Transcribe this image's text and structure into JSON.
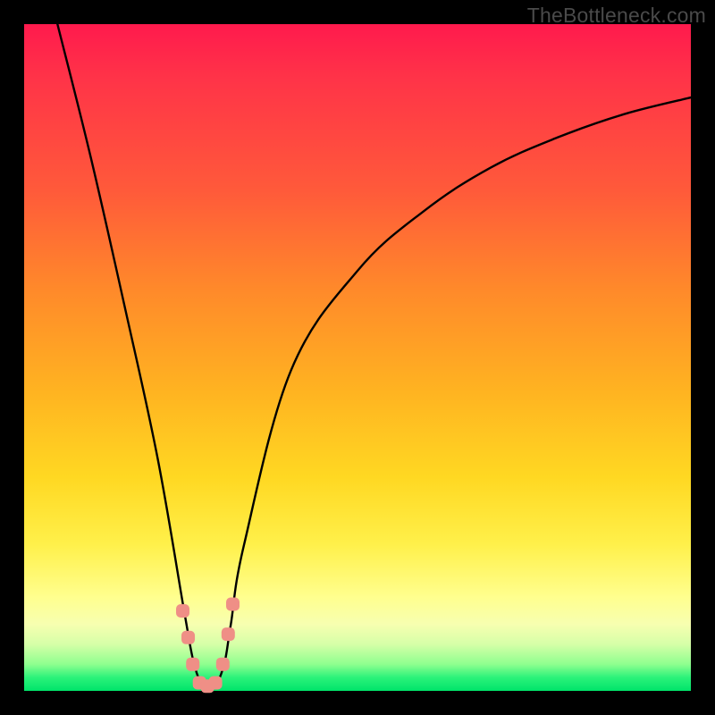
{
  "watermark": "TheBottleneck.com",
  "chart_data": {
    "type": "line",
    "title": "",
    "xlabel": "",
    "ylabel": "",
    "xlim": [
      0,
      100
    ],
    "ylim": [
      0,
      100
    ],
    "series": [
      {
        "name": "bottleneck-curve",
        "x": [
          5,
          10,
          15,
          20,
          24,
          25.5,
          27,
          28.5,
          30,
          31,
          33,
          40,
          50,
          60,
          70,
          80,
          90,
          100
        ],
        "values": [
          100,
          80,
          58,
          35,
          12,
          4,
          0.5,
          0.5,
          4,
          10,
          22,
          48,
          63,
          72,
          78.5,
          83,
          86.5,
          89
        ]
      }
    ],
    "markers": {
      "name": "shoulder-markers",
      "color": "#ef8f86",
      "points": [
        {
          "x": 23.8,
          "y": 12
        },
        {
          "x": 24.6,
          "y": 8
        },
        {
          "x": 25.3,
          "y": 4
        },
        {
          "x": 26.3,
          "y": 1.2
        },
        {
          "x": 27.5,
          "y": 0.7
        },
        {
          "x": 28.7,
          "y": 1.2
        },
        {
          "x": 29.8,
          "y": 4
        },
        {
          "x": 30.6,
          "y": 8.5
        },
        {
          "x": 31.3,
          "y": 13
        }
      ]
    },
    "gradient_stops": [
      {
        "pos": 0,
        "color": "#ff1a4d"
      },
      {
        "pos": 25,
        "color": "#ff5a3a"
      },
      {
        "pos": 55,
        "color": "#ffb321"
      },
      {
        "pos": 78,
        "color": "#fff04a"
      },
      {
        "pos": 90,
        "color": "#f7ffb0"
      },
      {
        "pos": 100,
        "color": "#00e46a"
      }
    ]
  }
}
